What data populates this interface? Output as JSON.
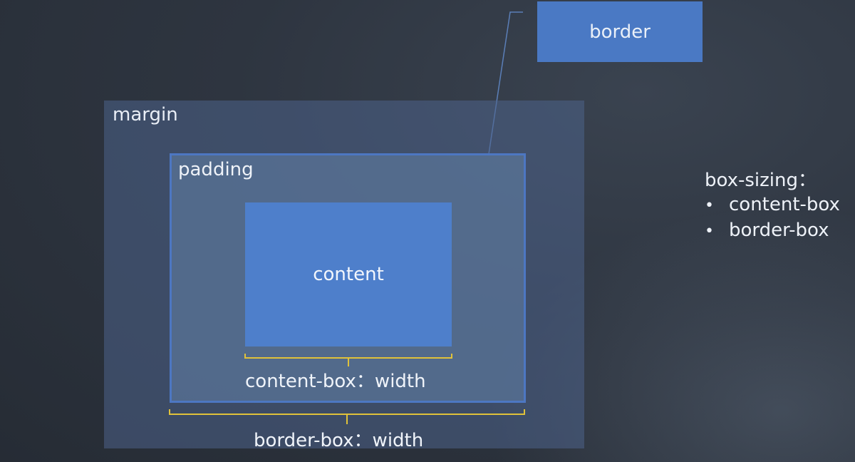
{
  "diagram": {
    "border_label": "border",
    "margin_label": "margin",
    "padding_label": "padding",
    "content_label": "content",
    "content_box_width_label": "content-box：width",
    "border_box_width_label": "border-box：width"
  },
  "box_sizing": {
    "title": "box-sizing：",
    "options": [
      {
        "label": "content-box"
      },
      {
        "label": "border-box"
      }
    ]
  },
  "colors": {
    "margin_fill": "#4c628a",
    "padding_fill": "#607ca2",
    "border_stroke": "#4d77c2",
    "content_fill": "#4e7fcb",
    "border_callout_fill": "#4a79c4",
    "brace_color": "#e0c23a",
    "leader_color": "#5b7fb8"
  }
}
